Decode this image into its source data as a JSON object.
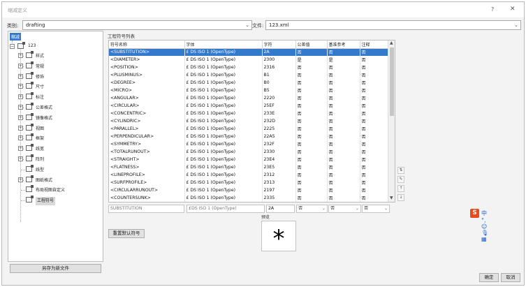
{
  "window": {
    "title": "缩减定义",
    "help": "?",
    "close": "✕"
  },
  "category": {
    "label": "类别:",
    "value": "drafting"
  },
  "file": {
    "label": "文件:",
    "value": "123.xml"
  },
  "tree": {
    "root_badge": "缩减",
    "root": "123",
    "items": [
      "样式",
      "常规",
      "修饰",
      "尺寸",
      "标注",
      "公差格式",
      "镜像格式",
      "视图",
      "框架",
      "线宽",
      "阵列",
      "线型",
      "图纸格式",
      "布局视图自定义",
      "工程符号"
    ]
  },
  "table_title": "工程符号列表",
  "columns": [
    "符号名称",
    "字体",
    "字符",
    "公差值",
    "基准参考",
    "注释"
  ],
  "rows": [
    [
      "<SUBSTITUTION>",
      "DS ISO 1 (OpenType)",
      "2A",
      "否",
      "否",
      "否"
    ],
    [
      "<DIAMETER>",
      "DS ISO 1 (OpenType)",
      "2300",
      "是",
      "是",
      "否"
    ],
    [
      "<POSITION>",
      "DS ISO 1 (OpenType)",
      "2316",
      "否",
      "否",
      "否"
    ],
    [
      "<PLUSMINUS>",
      "DS ISO 1 (OpenType)",
      "B1",
      "否",
      "否",
      "否"
    ],
    [
      "<DEGREE>",
      "DS ISO 1 (OpenType)",
      "B0",
      "否",
      "否",
      "否"
    ],
    [
      "<MICRO>",
      "DS ISO 1 (OpenType)",
      "B5",
      "否",
      "否",
      "否"
    ],
    [
      "<ANGULAR>",
      "DS ISO 1 (OpenType)",
      "2220",
      "否",
      "否",
      "否"
    ],
    [
      "<CIRCULAR>",
      "DS ISO 1 (OpenType)",
      "25EF",
      "否",
      "否",
      "否"
    ],
    [
      "<CONCENTRIC>",
      "DS ISO 1 (OpenType)",
      "233E",
      "否",
      "否",
      "否"
    ],
    [
      "<CYLINDRIC>",
      "DS ISO 1 (OpenType)",
      "232D",
      "否",
      "否",
      "否"
    ],
    [
      "<PARALLEL>",
      "DS ISO 1 (OpenType)",
      "2225",
      "否",
      "否",
      "否"
    ],
    [
      "<PERPENDICULAR>",
      "DS ISO 1 (OpenType)",
      "22A5",
      "否",
      "否",
      "否"
    ],
    [
      "<SYMMETRY>",
      "DS ISO 1 (OpenType)",
      "232F",
      "否",
      "否",
      "否"
    ],
    [
      "<TOTALRUNOUT>",
      "DS ISO 1 (OpenType)",
      "2330",
      "否",
      "否",
      "否"
    ],
    [
      "<STRAIGHT>",
      "DS ISO 1 (OpenType)",
      "23E4",
      "否",
      "否",
      "否"
    ],
    [
      "<FLATNESS>",
      "DS ISO 1 (OpenType)",
      "23E5",
      "否",
      "否",
      "否"
    ],
    [
      "<LINEPROFILE>",
      "DS ISO 1 (OpenType)",
      "2312",
      "否",
      "否",
      "否"
    ],
    [
      "<SURFPROFILE>",
      "DS ISO 1 (OpenType)",
      "2313",
      "否",
      "否",
      "否"
    ],
    [
      "<CIRCULARRUNOUT>",
      "DS ISO 1 (OpenType)",
      "2197",
      "否",
      "否",
      "否"
    ],
    [
      "<COUNTERSUNK>",
      "DS ISO 1 (OpenType)",
      "2335",
      "否",
      "否",
      "否"
    ]
  ],
  "editor": {
    "name": "SUBSTITUTION",
    "font": "DS ISO 1 (OpenType)",
    "char": "2A",
    "tolerance": "否",
    "datum": "否",
    "note": "否"
  },
  "preview": {
    "label": "预览",
    "symbol": "*"
  },
  "buttons": {
    "reset": "重置默认符号",
    "save_as": "另存为新文件",
    "ok": "确定",
    "cancel": "取消"
  },
  "ime": {
    "badge": "S",
    "text": "中 °, ☺ 🎙 ▦"
  },
  "colors": {
    "selection": "#3379cc",
    "ime_red": "#e8491d"
  }
}
